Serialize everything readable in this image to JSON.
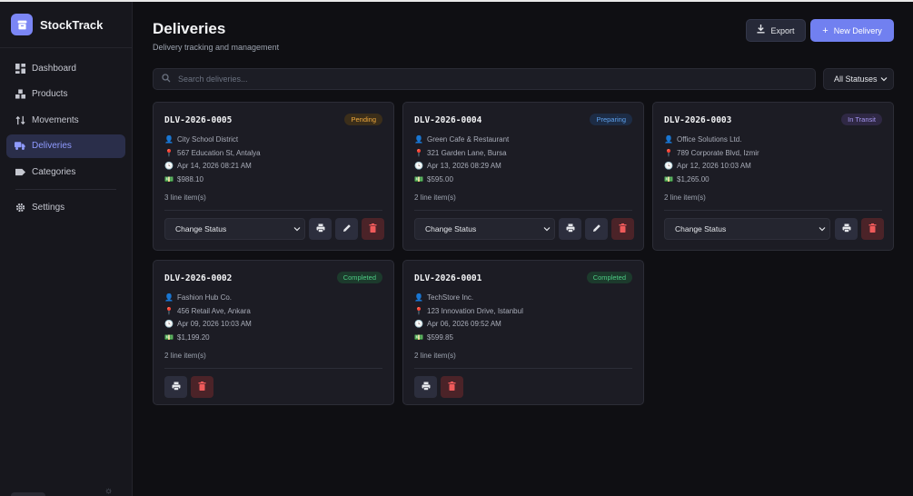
{
  "app": {
    "name": "StockTrack"
  },
  "sidebar": {
    "items": [
      {
        "label": "Dashboard",
        "icon": "dashboard-icon"
      },
      {
        "label": "Products",
        "icon": "boxes-icon"
      },
      {
        "label": "Movements",
        "icon": "arrows-icon"
      },
      {
        "label": "Deliveries",
        "icon": "truck-icon",
        "active": true
      },
      {
        "label": "Categories",
        "icon": "tag-icon"
      },
      {
        "label": "Settings",
        "icon": "gear-icon"
      }
    ]
  },
  "header": {
    "title": "Deliveries",
    "subtitle": "Delivery tracking and management",
    "export_label": "Export",
    "new_label": "New Delivery"
  },
  "search": {
    "placeholder": "Search deliveries..."
  },
  "status_filter": {
    "selected": "All Statuses"
  },
  "colors": {
    "accent": "#7180f0",
    "pending": "#f0a93c",
    "preparing": "#5ea2ee",
    "in_transit": "#a597f2",
    "completed": "#4ccb83"
  },
  "deliveries": [
    {
      "id": "DLV-2026-0005",
      "status": "Pending",
      "customer": "City School District",
      "address": "567 Education St, Antalya",
      "date": "Apr 14, 2026 08:21 AM",
      "amount": "$988.10",
      "items": "3 line item(s)",
      "action": "Change Status"
    },
    {
      "id": "DLV-2026-0004",
      "status": "Preparing",
      "customer": "Green Cafe & Restaurant",
      "address": "321 Garden Lane, Bursa",
      "date": "Apr 13, 2026 08:29 AM",
      "amount": "$595.00",
      "items": "2 line item(s)",
      "action": "Change Status"
    },
    {
      "id": "DLV-2026-0003",
      "status": "In Transit",
      "customer": "Office Solutions Ltd.",
      "address": "789 Corporate Blvd, Izmir",
      "date": "Apr 12, 2026 10:03 AM",
      "amount": "$1,265.00",
      "items": "2 line item(s)",
      "action": "Change Status"
    },
    {
      "id": "DLV-2026-0002",
      "status": "Completed",
      "customer": "Fashion Hub Co.",
      "address": "456 Retail Ave, Ankara",
      "date": "Apr 09, 2026 10:03 AM",
      "amount": "$1,199.20",
      "items": "2 line item(s)"
    },
    {
      "id": "DLV-2026-0001",
      "status": "Completed",
      "customer": "TechStore Inc.",
      "address": "123 Innovation Drive, Istanbul",
      "date": "Apr 06, 2026 09:52 AM",
      "amount": "$599.85",
      "items": "2 line item(s)"
    }
  ]
}
